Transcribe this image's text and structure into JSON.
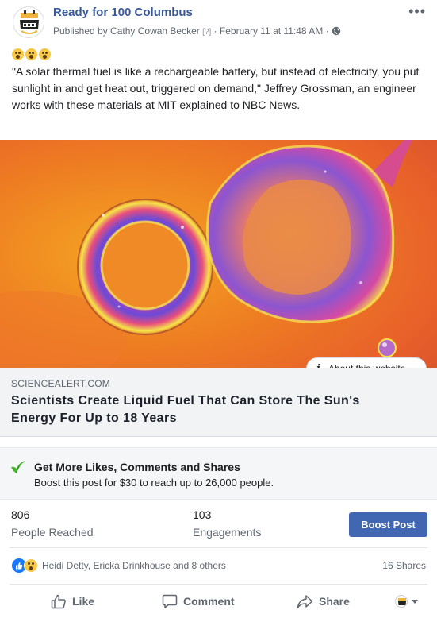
{
  "post": {
    "page_name": "Ready for 100 Columbus",
    "published_prefix": "Published by ",
    "author": "Cathy Cowan Becker",
    "help_marker": "[?]",
    "separator": "·",
    "timestamp": "February 11 at 11:48 AM",
    "audience_icon": "globe-icon",
    "more_icon": "•••",
    "emoji_icons": [
      "wow-face-emoji",
      "wow-face-emoji",
      "wow-face-emoji"
    ],
    "text": "\"A solar thermal fuel is like a rechargeable battery, but instead of electricity, you put sunlight in and get heat out, triggered on demand,\" Jeffrey Grossman, an engineer works with these materials at MIT explained to NBC News."
  },
  "link_preview": {
    "about_label": "About this website",
    "domain": "SCIENCEALERT.COM",
    "headline": "Scientists Create Liquid Fuel That Can Store The Sun's Energy For Up to 18 Years"
  },
  "promo": {
    "title": "Get More Likes, Comments and Shares",
    "subtitle": "Boost this post for $30 to reach up to 26,000 people."
  },
  "stats": {
    "reached_value": "806",
    "reached_label": "People Reached",
    "engagements_value": "103",
    "engagements_label": "Engagements",
    "boost_label": "Boost Post"
  },
  "reactions": {
    "names": "Heidi Detty, Ericka Drinkhouse and 8 others",
    "shares": "16 Shares"
  },
  "actions": {
    "like": "Like",
    "comment": "Comment",
    "share": "Share"
  },
  "colors": {
    "brand_link": "#385898",
    "boost_button": "#4267b2",
    "like_blue": "#1877f2"
  }
}
